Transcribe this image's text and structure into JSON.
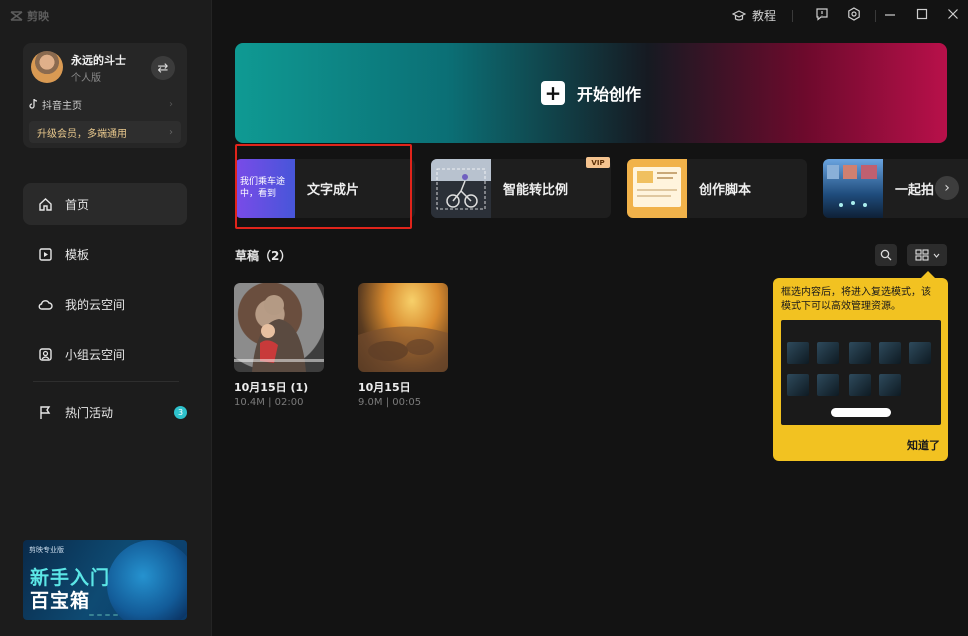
{
  "app": {
    "logo_text": "剪映"
  },
  "topbar": {
    "tutorial_label": "教程"
  },
  "profile": {
    "username": "永远的斗士",
    "plan": "个人版",
    "douyin_link": "抖音主页",
    "vip_promo": "升级会员，多端通用"
  },
  "nav": {
    "items": [
      {
        "label": "首页"
      },
      {
        "label": "模板"
      },
      {
        "label": "我的云空间"
      },
      {
        "label": "小组云空间"
      },
      {
        "label": "热门活动",
        "badge": "3"
      }
    ]
  },
  "promo": {
    "brand": "剪映专业版",
    "line1": "新手入门",
    "line2": "百宝箱"
  },
  "hero": {
    "label": "开始创作"
  },
  "tools": [
    {
      "label": "文字成片",
      "thumb_text": "我们乘车途中，看到"
    },
    {
      "label": "智能转比例",
      "tag": "VIP"
    },
    {
      "label": "创作脚本"
    },
    {
      "label": "一起拍"
    }
  ],
  "drafts": {
    "title": "草稿（2）",
    "items": [
      {
        "title": "10月15日 (1)",
        "meta": "10.4M | 02:00"
      },
      {
        "title": "10月15日",
        "meta": "9.0M | 00:05"
      }
    ]
  },
  "tooltip": {
    "text": "框选内容后，将进入复选模式，该模式下可以高效管理资源。",
    "ok_label": "知道了"
  },
  "colors": {
    "accent_teal": "#0f9a93",
    "accent_red": "#b8104a",
    "selection_outline": "#e0241b",
    "tooltip_bg": "#f2c221",
    "badge": "#2ec2cc"
  }
}
